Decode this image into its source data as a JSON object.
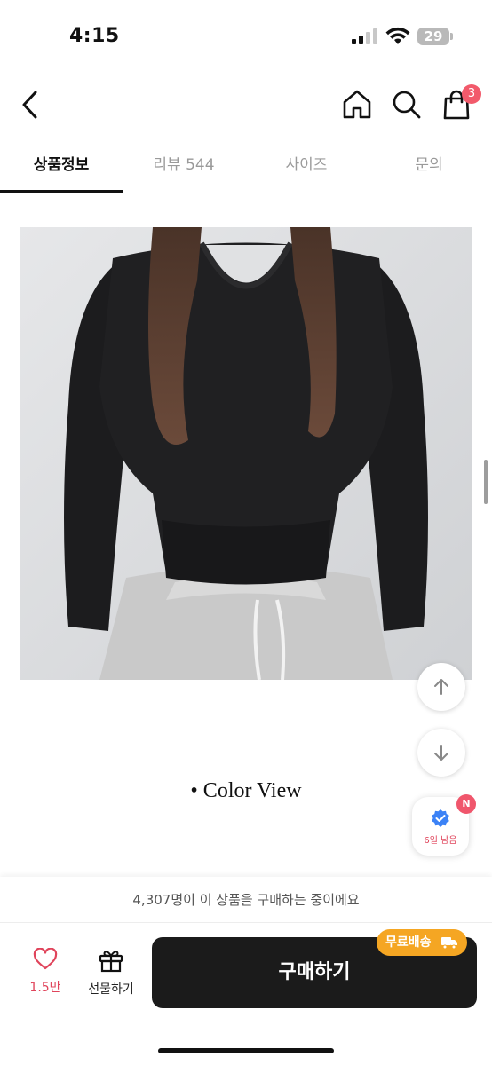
{
  "status_bar": {
    "time": "4:15",
    "battery_level": "29"
  },
  "nav": {
    "cart_count": "3"
  },
  "tabs": [
    {
      "label": "상품정보",
      "active": true
    },
    {
      "label": "리뷰 544",
      "active": false
    },
    {
      "label": "사이즈",
      "active": false
    },
    {
      "label": "문의",
      "active": false
    }
  ],
  "content": {
    "color_view_heading": "• Color View"
  },
  "event_widget": {
    "badge": "N",
    "label": "6일 남음"
  },
  "bottom_bar": {
    "buyers_text": "4,307명이 이 상품을 구매하는 중이에요",
    "like_count": "1.5만",
    "gift_label": "선물하기",
    "buy_label": "구매하기",
    "free_shipping_label": "무료배송"
  },
  "colors": {
    "accent_pink": "#e0445b",
    "buy_button": "#1b1b1b",
    "free_ship": "#f5a623"
  },
  "icons": [
    "back-icon",
    "home-icon",
    "search-icon",
    "cart-icon",
    "arrow-up-icon",
    "arrow-down-icon",
    "verified-icon",
    "heart-icon",
    "gift-icon",
    "truck-icon"
  ]
}
